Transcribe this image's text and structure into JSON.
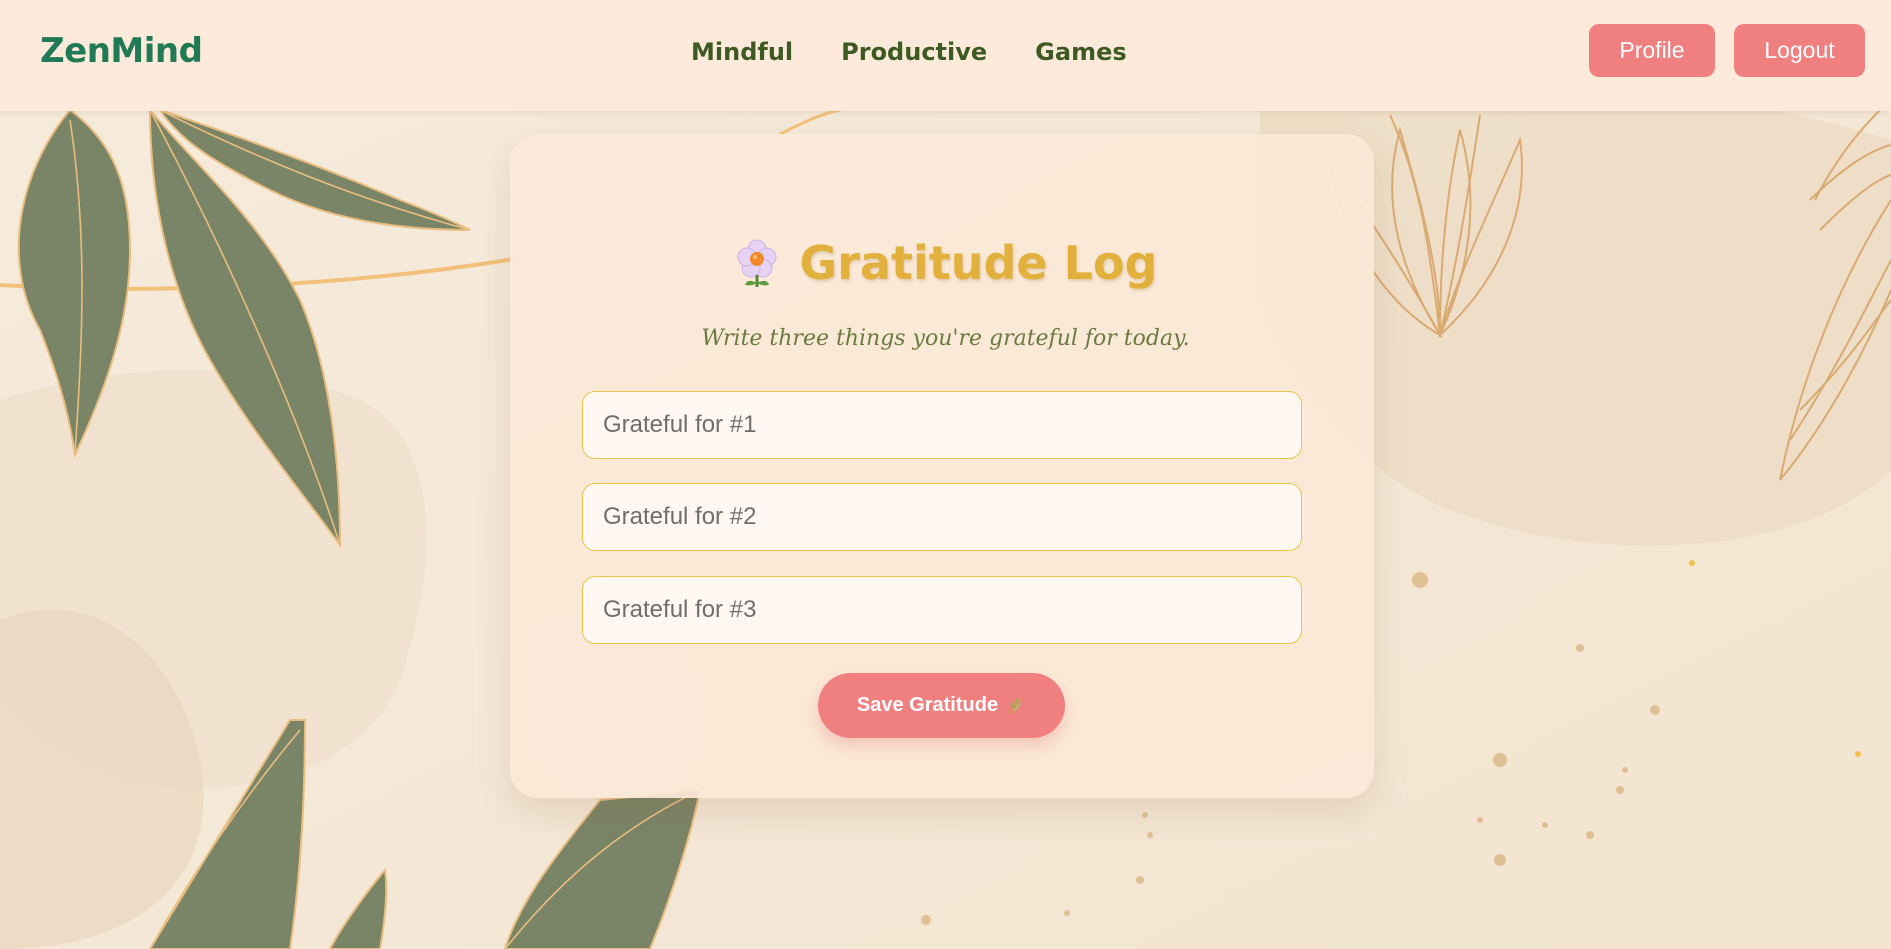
{
  "header": {
    "logo": "ZenMind",
    "nav": [
      "Mindful",
      "Productive",
      "Games"
    ],
    "profile_label": "Profile",
    "logout_label": "Logout"
  },
  "card": {
    "title": "Gratitude Log",
    "subtitle": "Write three things you're grateful for today.",
    "fields": [
      {
        "placeholder": "Grateful for #1",
        "value": ""
      },
      {
        "placeholder": "Grateful for #2",
        "value": ""
      },
      {
        "placeholder": "Grateful for #3",
        "value": ""
      }
    ],
    "save_label": "Save Gratitude",
    "title_icon": "flower-icon",
    "save_icon": "leaf-icon"
  },
  "colors": {
    "brand": "#1f7a55",
    "accent": "#f08080",
    "title": "#e2b03c",
    "nav_text": "#3d5a22",
    "header_bg": "#fdeadb",
    "page_bg": "#f3e8d8",
    "leaf": "#7a8466",
    "gold_line": "#f2c07a"
  }
}
